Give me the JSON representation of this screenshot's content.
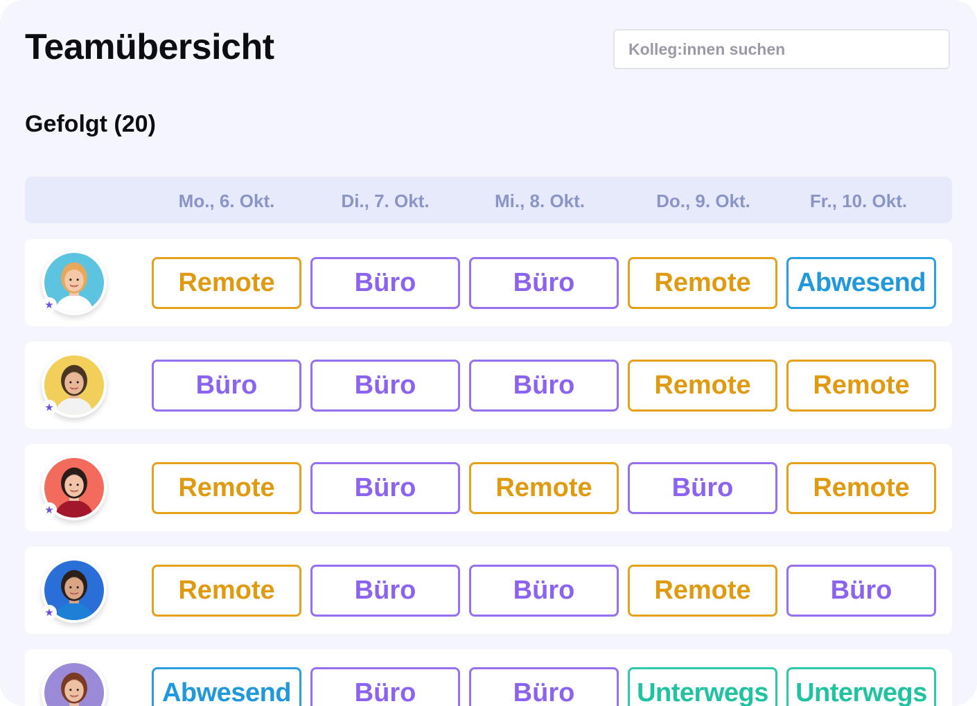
{
  "app": {
    "title": "Teamübersicht",
    "search_placeholder": "Kolleg:innen suchen",
    "section_title": "Gefolgt (20)"
  },
  "days": [
    "Mo., 6. Okt.",
    "Di., 7. Okt.",
    "Mi., 8. Okt.",
    "Do., 9. Okt.",
    "Fr., 10. Okt."
  ],
  "status_colors": {
    "remote": "#e6a11c",
    "buero": "#9670f0",
    "abw": "#2a9fe0",
    "unt": "#2bc9a8",
    "favorite_star": "#6b4fdc"
  },
  "rows": [
    {
      "avatar": {
        "bg": "#5cc4e0",
        "hair": "#e7a85c",
        "skin": "#f3c9a7",
        "shirt": "#ffffff"
      },
      "favorite_icon": "star-icon",
      "statuses": [
        {
          "label": "Remote",
          "type": "remote"
        },
        {
          "label": "Büro",
          "type": "buero"
        },
        {
          "label": "Büro",
          "type": "buero"
        },
        {
          "label": "Remote",
          "type": "remote"
        },
        {
          "label": "Abwesend",
          "type": "abw"
        }
      ]
    },
    {
      "avatar": {
        "bg": "#f2cf5b",
        "hair": "#4a3424",
        "skin": "#e8b896",
        "shirt": "#f2f2f2"
      },
      "favorite_icon": "star-icon",
      "statuses": [
        {
          "label": "Büro",
          "type": "buero"
        },
        {
          "label": "Büro",
          "type": "buero"
        },
        {
          "label": "Büro",
          "type": "buero"
        },
        {
          "label": "Remote",
          "type": "remote"
        },
        {
          "label": "Remote",
          "type": "remote"
        }
      ]
    },
    {
      "avatar": {
        "bg": "#f26b5c",
        "hair": "#2a1c18",
        "skin": "#f1c4a8",
        "shirt": "#a3172c"
      },
      "favorite_icon": "star-icon",
      "statuses": [
        {
          "label": "Remote",
          "type": "remote"
        },
        {
          "label": "Büro",
          "type": "buero"
        },
        {
          "label": "Remote",
          "type": "remote"
        },
        {
          "label": "Büro",
          "type": "buero"
        },
        {
          "label": "Remote",
          "type": "remote"
        }
      ]
    },
    {
      "avatar": {
        "bg": "#2a6fd8",
        "hair": "#2b1f18",
        "skin": "#d9a585",
        "shirt": "#1d7fd6"
      },
      "favorite_icon": "star-icon",
      "statuses": [
        {
          "label": "Remote",
          "type": "remote"
        },
        {
          "label": "Büro",
          "type": "buero"
        },
        {
          "label": "Büro",
          "type": "buero"
        },
        {
          "label": "Remote",
          "type": "remote"
        },
        {
          "label": "Büro",
          "type": "buero"
        }
      ]
    },
    {
      "avatar": {
        "bg": "#9a8ad8",
        "hair": "#7a3a24",
        "skin": "#eec0a2",
        "shirt": "#6a5ab8"
      },
      "favorite_icon": "star-icon",
      "statuses": [
        {
          "label": "Abwesend",
          "type": "abw"
        },
        {
          "label": "Büro",
          "type": "buero"
        },
        {
          "label": "Büro",
          "type": "buero"
        },
        {
          "label": "Unterwegs",
          "type": "unt"
        },
        {
          "label": "Unterwegs",
          "type": "unt"
        }
      ]
    }
  ]
}
